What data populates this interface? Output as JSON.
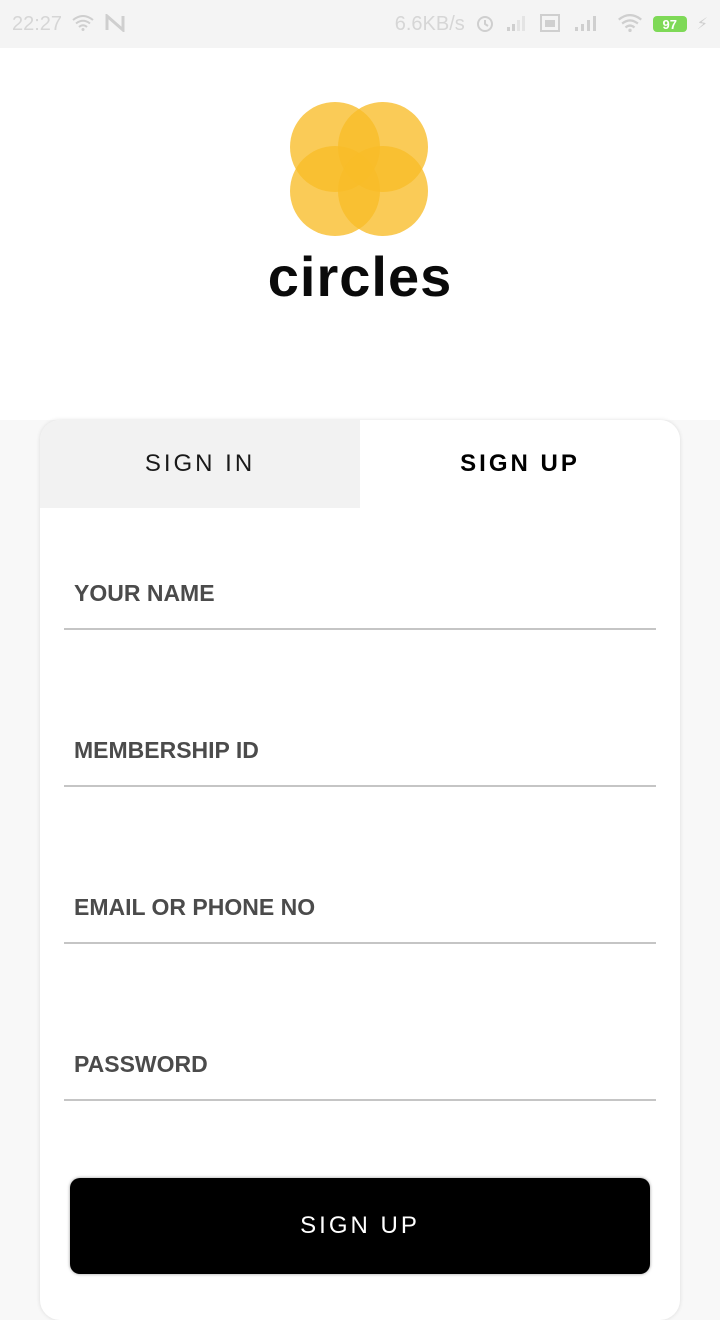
{
  "status_bar": {
    "time": "22:27",
    "network_speed": "6.6KB/s",
    "battery": "97",
    "icons": [
      "wifi-icon",
      "n-notification-icon",
      "alarm-icon",
      "signal-icon",
      "vpn-icon",
      "signal-4g-icon",
      "wifi-icon",
      "battery-icon",
      "charging-icon"
    ]
  },
  "brand": {
    "name": "circles",
    "logo_color": "#f8bc28"
  },
  "tabs": {
    "sign_in": "SIGN IN",
    "sign_up": "SIGN UP",
    "active": "sign_up"
  },
  "form": {
    "name_placeholder": "YOUR NAME",
    "membership_placeholder": "MEMBERSHIP ID",
    "contact_placeholder": "EMAIL OR PHONE NO",
    "password_placeholder": "PASSWORD",
    "submit_label": "SIGN UP"
  }
}
